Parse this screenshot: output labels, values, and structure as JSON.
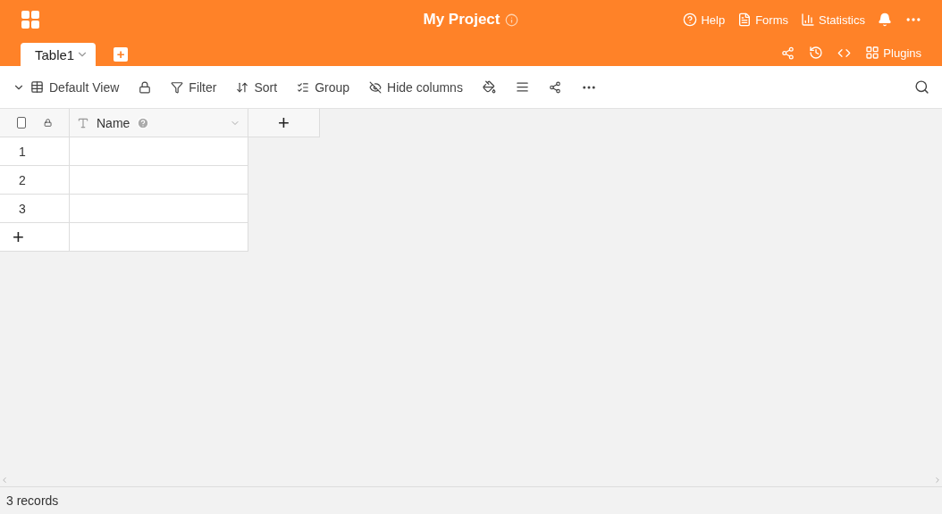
{
  "app": {
    "title": "My Project"
  },
  "top_actions": [
    {
      "kind": "help",
      "label": "Help"
    },
    {
      "kind": "forms",
      "label": "Forms"
    },
    {
      "kind": "statistics",
      "label": "Statistics"
    }
  ],
  "table_tabs": [
    {
      "label": "Table1",
      "selected": true
    }
  ],
  "add_table": "+",
  "plugins": {
    "label": "Plugins"
  },
  "view": {
    "name": "Default View"
  },
  "toolbar": [
    {
      "kind": "filter",
      "label": "Filter"
    },
    {
      "kind": "sort",
      "label": "Sort"
    },
    {
      "kind": "group",
      "label": "Group"
    },
    {
      "kind": "hide",
      "label": "Hide columns"
    }
  ],
  "grid": {
    "select_all": {
      "checked": false
    },
    "columns": [
      {
        "name": "Name"
      }
    ],
    "add_column": "+",
    "rows": [
      {
        "number": "1"
      },
      {
        "number": "2"
      },
      {
        "number": "3"
      }
    ],
    "add_row": "+"
  },
  "status_bar": {
    "records": "3 records"
  }
}
